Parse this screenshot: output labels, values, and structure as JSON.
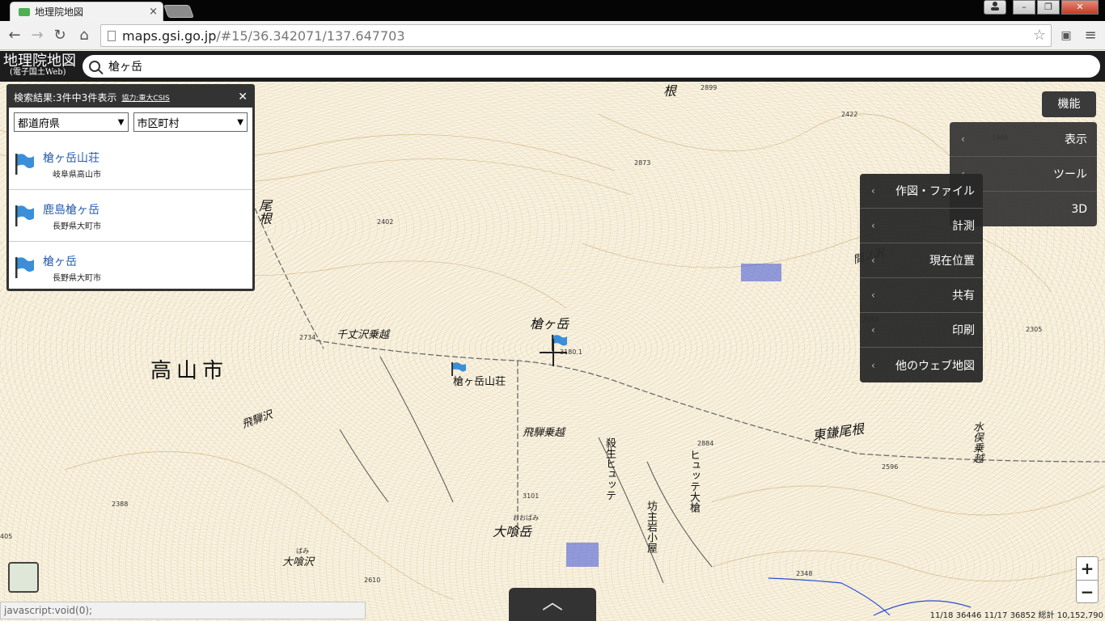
{
  "browser": {
    "tab_title": "地理院地図",
    "tab_close": "×",
    "url_host": "maps.gsi.go.jp",
    "url_rest": "/#15/36.342071/137.647703",
    "window_buttons": [
      "–",
      "❐",
      "✕"
    ]
  },
  "app": {
    "logo_main": "地理院地図",
    "logo_sub": "(電子国土Web)",
    "search_value": "槍ヶ岳"
  },
  "results": {
    "header": "検索結果:3件中3件表示",
    "credit": "協力:東大CSIS",
    "close": "✕",
    "prefecture_select": "都道府県",
    "city_select": "市区町村",
    "items": [
      {
        "name": "槍ヶ岳山荘",
        "address": "岐阜県高山市"
      },
      {
        "name": "鹿島槍ヶ岳",
        "address": "長野県大町市"
      },
      {
        "name": "槍ヶ岳",
        "address": "長野県大町市"
      }
    ]
  },
  "function_button": "機能",
  "menu_main": [
    "表示",
    "ツール",
    "3D"
  ],
  "menu_sub": [
    "作図・ファイル",
    "計測",
    "現在位置",
    "共有",
    "印刷",
    "他のウェブ地図"
  ],
  "map_labels": {
    "city": "高山市",
    "yari": "槍ヶ岳",
    "yari_hut": "槍ヶ岳山荘",
    "senjo_pass": "千丈沢乗越",
    "hida_sawa": "飛騨沢",
    "hida_pass": "飛騨乗越",
    "higashi_kama": "東鎌尾根",
    "ohbami": "大喰岳",
    "ohbami_sawa": "大喰沢",
    "ohbami_ruby": "おおばみ",
    "ohbami_sawa_ruby": "ばみ",
    "sessho": "殺生ヒュッテ",
    "hutte_ohyari": "ヒュッテ大槍",
    "bozu": "坊主岩小屋",
    "mizumata": "水俣乗越",
    "ne_top": "根",
    "one_left": "尾根",
    "ai_sawa": "間ノ沢",
    "el_2899": "2899",
    "el_2422": "2422",
    "el_2873": "2873",
    "el_2402": "2402",
    "el_2734": "2734",
    "el_3180": "3180.1",
    "el_2310": "2310",
    "el_2305": "2305",
    "el_2884": "2884",
    "el_2596": "2596",
    "el_3101": "3101",
    "el_2388": "2388",
    "el_405": "405",
    "el_2610": "2610",
    "el_2348": "2348",
    "el_1900": "1900"
  },
  "status_text": "javascript:void(0);",
  "zoom_in": "+",
  "zoom_out": "−",
  "pullup": "︿",
  "coords_text": "11/18 36446  11/17 36852  総計 10,152,790"
}
